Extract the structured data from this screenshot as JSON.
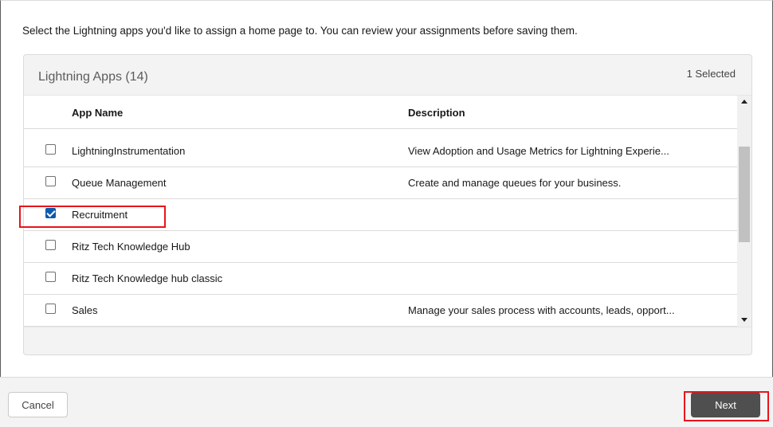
{
  "instruction": "Select the Lightning apps you'd like to assign a home page to. You can review your assignments before saving them.",
  "card": {
    "title": "Lightning Apps (14)",
    "selected_count": "1 Selected"
  },
  "table": {
    "headers": {
      "name": "App Name",
      "description": "Description"
    },
    "rows": [
      {
        "name": "LightningInstrumentation",
        "description": "View Adoption and Usage Metrics for Lightning Experie...",
        "checked": false
      },
      {
        "name": "Queue Management",
        "description": "Create and manage queues for your business.",
        "checked": false
      },
      {
        "name": "Recruitment",
        "description": "",
        "checked": true
      },
      {
        "name": "Ritz Tech Knowledge Hub",
        "description": "",
        "checked": false
      },
      {
        "name": "Ritz Tech Knowledge hub classic",
        "description": "",
        "checked": false
      },
      {
        "name": "Sales",
        "description": "Manage your sales process with accounts, leads, opport...",
        "checked": false
      }
    ]
  },
  "footer": {
    "cancel_label": "Cancel",
    "next_label": "Next"
  },
  "colors": {
    "accent_checkbox": "#0b5cab",
    "highlight": "#e8141b",
    "next_button": "#4f4f4f"
  }
}
